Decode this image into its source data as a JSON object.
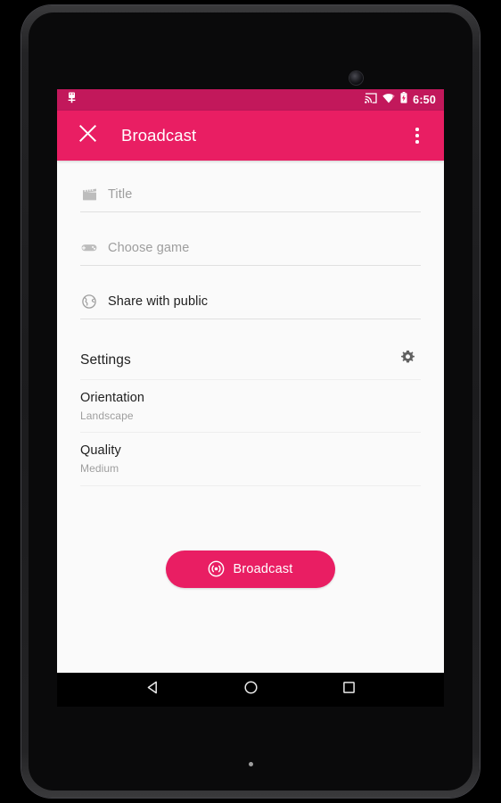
{
  "device": {
    "camera_icon": "front-camera-icon",
    "led_indicator": "notification-led"
  },
  "status_bar": {
    "background_color": "#C2185B",
    "notification_icon": "app-notification-icon",
    "cast_icon": "cast-screen-icon",
    "wifi_icon": "wifi-icon",
    "battery_icon": "battery-charging-icon",
    "time": "6:50"
  },
  "app_bar": {
    "background_color": "#E91E63",
    "close_icon": "close-icon",
    "title": "Broadcast",
    "overflow_icon": "more-vert-icon"
  },
  "form": {
    "fields": [
      {
        "icon": "movie-clapper-icon",
        "text": "Title",
        "filled": false
      },
      {
        "icon": "gamepad-icon",
        "text": "Choose game",
        "filled": false
      },
      {
        "icon": "globe-icon",
        "text": "Share with public",
        "filled": true
      }
    ]
  },
  "settings": {
    "header_label": "Settings",
    "gear_icon": "gear-icon",
    "rows": [
      {
        "label": "Orientation",
        "value": "Landscape"
      },
      {
        "label": "Quality",
        "value": "Medium"
      }
    ]
  },
  "broadcast": {
    "icon": "broadcast-icon",
    "label": "Broadcast",
    "color": "#E91E63"
  },
  "nav_bar": {
    "back_icon": "back-triangle-icon",
    "home_icon": "home-circle-icon",
    "recents_icon": "recents-square-icon"
  }
}
